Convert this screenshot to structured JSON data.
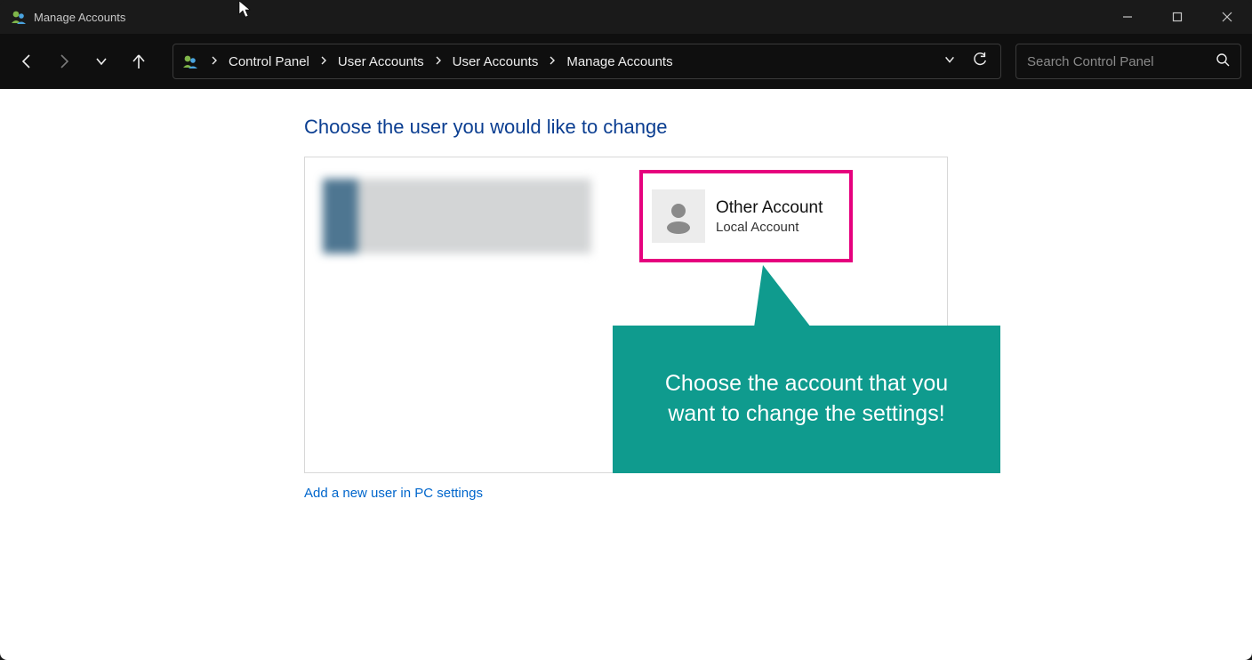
{
  "window": {
    "title": "Manage Accounts"
  },
  "breadcrumb": {
    "items": [
      "Control Panel",
      "User Accounts",
      "User Accounts",
      "Manage Accounts"
    ]
  },
  "search": {
    "placeholder": "Search Control Panel"
  },
  "page": {
    "heading": "Choose the user you would like to change",
    "add_link": "Add a new user in PC settings"
  },
  "accounts": {
    "highlighted": {
      "name": "Other Account",
      "type": "Local Account"
    }
  },
  "callout": {
    "text": "Choose the account that you want to change the settings!"
  },
  "colors": {
    "highlight": "#e6007e",
    "callout": "#0f9b8e",
    "heading": "#0b3e91",
    "link": "#0066cc"
  }
}
